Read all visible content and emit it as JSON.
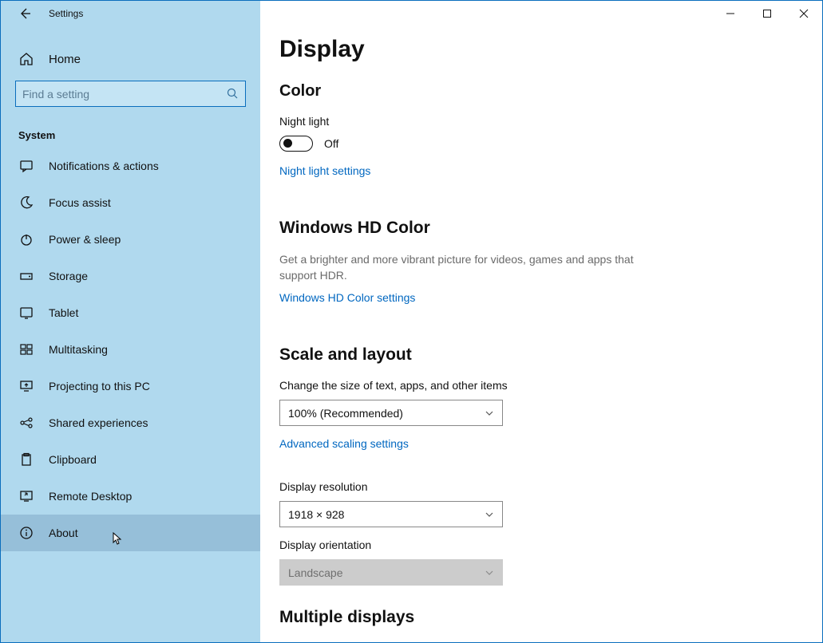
{
  "window": {
    "title": "Settings"
  },
  "sidebar": {
    "home": "Home",
    "search_placeholder": "Find a setting",
    "category": "System",
    "items": [
      {
        "key": "notifications",
        "label": "Notifications & actions"
      },
      {
        "key": "focus-assist",
        "label": "Focus assist"
      },
      {
        "key": "power-sleep",
        "label": "Power & sleep"
      },
      {
        "key": "storage",
        "label": "Storage"
      },
      {
        "key": "tablet",
        "label": "Tablet"
      },
      {
        "key": "multitasking",
        "label": "Multitasking"
      },
      {
        "key": "projecting",
        "label": "Projecting to this PC"
      },
      {
        "key": "shared-exp",
        "label": "Shared experiences"
      },
      {
        "key": "clipboard",
        "label": "Clipboard"
      },
      {
        "key": "remote-desktop",
        "label": "Remote Desktop"
      },
      {
        "key": "about",
        "label": "About"
      }
    ]
  },
  "page": {
    "title": "Display",
    "color": {
      "heading": "Color",
      "night_light_label": "Night light",
      "night_light_state": "Off",
      "night_light_settings_link": "Night light settings"
    },
    "hdcolor": {
      "heading": "Windows HD Color",
      "desc": "Get a brighter and more vibrant picture for videos, games and apps that support HDR.",
      "link": "Windows HD Color settings"
    },
    "scale": {
      "heading": "Scale and layout",
      "text_size_label": "Change the size of text, apps, and other items",
      "text_size_value": "100% (Recommended)",
      "advanced_link": "Advanced scaling settings",
      "resolution_label": "Display resolution",
      "resolution_value": "1918 × 928",
      "orientation_label": "Display orientation",
      "orientation_value": "Landscape"
    },
    "multiple_displays_heading": "Multiple displays"
  }
}
